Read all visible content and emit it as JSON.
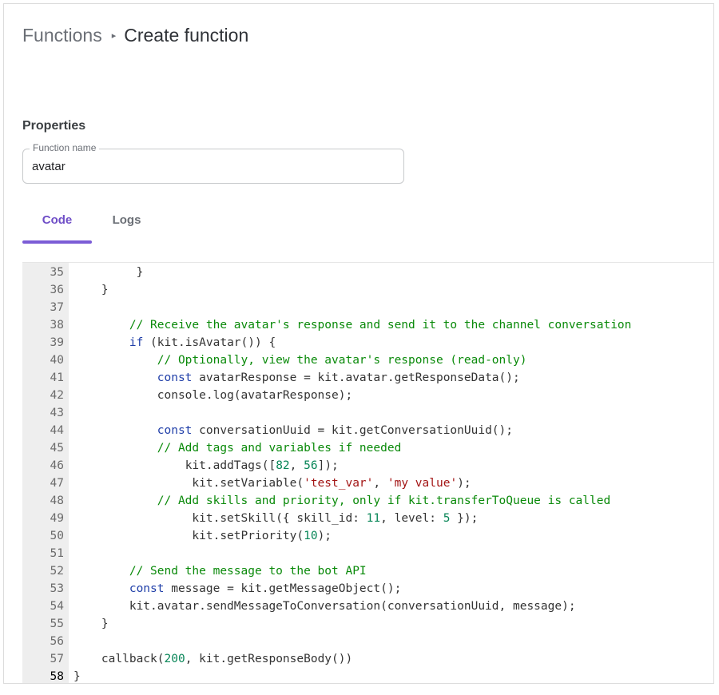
{
  "breadcrumb": {
    "parent": "Functions",
    "separator": "▸",
    "current": "Create function"
  },
  "properties": {
    "title": "Properties",
    "function_name_label": "Function name",
    "function_name_value": "avatar"
  },
  "tabs": [
    {
      "label": "Code",
      "active": true
    },
    {
      "label": "Logs",
      "active": false
    }
  ],
  "colors": {
    "accent": "#7b5cd6",
    "comment": "#0a8a0a",
    "keyword": "#1f3ea8",
    "string": "#a31515",
    "number": "#098658"
  },
  "editor": {
    "current_line": 58,
    "lines": [
      {
        "n": 35,
        "indent": 9,
        "tokens": [
          [
            "t",
            "}"
          ]
        ]
      },
      {
        "n": 36,
        "indent": 4,
        "tokens": [
          [
            "t",
            "}"
          ]
        ]
      },
      {
        "n": 37,
        "indent": 0,
        "tokens": []
      },
      {
        "n": 38,
        "indent": 8,
        "tokens": [
          [
            "c",
            "// Receive the avatar's response and send it to the channel conversation"
          ]
        ]
      },
      {
        "n": 39,
        "indent": 8,
        "tokens": [
          [
            "k",
            "if"
          ],
          [
            "t",
            " (kit.isAvatar()) {"
          ]
        ]
      },
      {
        "n": 40,
        "indent": 12,
        "tokens": [
          [
            "c",
            "// Optionally, view the avatar's response (read-only)"
          ]
        ]
      },
      {
        "n": 41,
        "indent": 12,
        "tokens": [
          [
            "k",
            "const"
          ],
          [
            "t",
            " avatarResponse = kit.avatar.getResponseData();"
          ]
        ]
      },
      {
        "n": 42,
        "indent": 12,
        "tokens": [
          [
            "t",
            "console.log(avatarResponse);"
          ]
        ]
      },
      {
        "n": 43,
        "indent": 0,
        "tokens": []
      },
      {
        "n": 44,
        "indent": 12,
        "tokens": [
          [
            "k",
            "const"
          ],
          [
            "t",
            " conversationUuid = kit.getConversationUuid();"
          ]
        ]
      },
      {
        "n": 45,
        "indent": 12,
        "tokens": [
          [
            "c",
            "// Add tags and variables if needed"
          ]
        ]
      },
      {
        "n": 46,
        "indent": 16,
        "tokens": [
          [
            "t",
            "kit.addTags(["
          ],
          [
            "n",
            "82"
          ],
          [
            "t",
            ", "
          ],
          [
            "n",
            "56"
          ],
          [
            "t",
            "]);"
          ]
        ]
      },
      {
        "n": 47,
        "indent": 17,
        "tokens": [
          [
            "t",
            "kit.setVariable("
          ],
          [
            "s",
            "'test_var'"
          ],
          [
            "t",
            ", "
          ],
          [
            "s",
            "'my value'"
          ],
          [
            "t",
            ");"
          ]
        ]
      },
      {
        "n": 48,
        "indent": 12,
        "tokens": [
          [
            "c",
            "// Add skills and priority, only if kit.transferToQueue is called"
          ]
        ]
      },
      {
        "n": 49,
        "indent": 17,
        "tokens": [
          [
            "t",
            "kit.setSkill({ skill_id: "
          ],
          [
            "n",
            "11"
          ],
          [
            "t",
            ", level: "
          ],
          [
            "n",
            "5"
          ],
          [
            "t",
            " });"
          ]
        ]
      },
      {
        "n": 50,
        "indent": 17,
        "tokens": [
          [
            "t",
            "kit.setPriority("
          ],
          [
            "n",
            "10"
          ],
          [
            "t",
            ");"
          ]
        ]
      },
      {
        "n": 51,
        "indent": 0,
        "tokens": []
      },
      {
        "n": 52,
        "indent": 8,
        "tokens": [
          [
            "c",
            "// Send the message to the bot API"
          ]
        ]
      },
      {
        "n": 53,
        "indent": 8,
        "tokens": [
          [
            "k",
            "const"
          ],
          [
            "t",
            " message = kit.getMessageObject();"
          ]
        ]
      },
      {
        "n": 54,
        "indent": 8,
        "tokens": [
          [
            "t",
            "kit.avatar.sendMessageToConversation(conversationUuid, message);"
          ]
        ]
      },
      {
        "n": 55,
        "indent": 4,
        "tokens": [
          [
            "t",
            "}"
          ]
        ]
      },
      {
        "n": 56,
        "indent": 0,
        "tokens": []
      },
      {
        "n": 57,
        "indent": 4,
        "tokens": [
          [
            "t",
            "callback("
          ],
          [
            "n",
            "200"
          ],
          [
            "t",
            ", kit.getResponseBody())"
          ]
        ]
      },
      {
        "n": 58,
        "indent": 0,
        "tokens": [
          [
            "t",
            "}"
          ]
        ]
      }
    ]
  }
}
